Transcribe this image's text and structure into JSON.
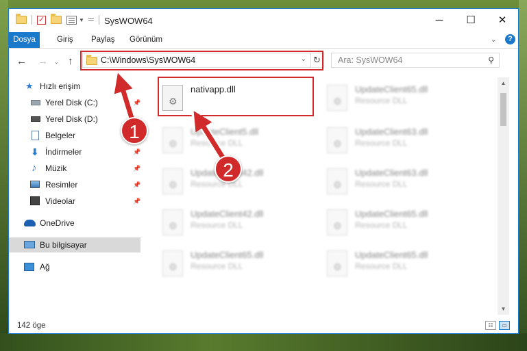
{
  "window": {
    "title": "SysWOW64"
  },
  "ribbon": {
    "tabs": [
      "Dosya",
      "Giriş",
      "Paylaş",
      "Görünüm"
    ],
    "help": "?"
  },
  "nav": {
    "address": "C:\\Windows\\SysWOW64",
    "search_placeholder": "Ara: SysWOW64"
  },
  "sidebar": {
    "items": [
      {
        "label": "Hızlı erişim",
        "icon": "star-icon"
      },
      {
        "label": "Yerel Disk (C:)",
        "icon": "drive-icon",
        "pinned": true
      },
      {
        "label": "Yerel Disk (D:)",
        "icon": "drive-icon"
      },
      {
        "label": "Belgeler",
        "icon": "documents-icon"
      },
      {
        "label": "İndirmeler",
        "icon": "download-icon",
        "pinned": true
      },
      {
        "label": "Müzik",
        "icon": "music-icon",
        "pinned": true
      },
      {
        "label": "Resimler",
        "icon": "pictures-icon",
        "pinned": true
      },
      {
        "label": "Videolar",
        "icon": "video-icon",
        "pinned": true
      },
      {
        "label": "OneDrive",
        "icon": "cloud-icon"
      },
      {
        "label": "Bu bilgisayar",
        "icon": "computer-icon",
        "selected": true
      },
      {
        "label": "Ağ",
        "icon": "network-icon"
      }
    ]
  },
  "files": [
    {
      "name": "nativapp.dll",
      "type": ""
    },
    {
      "name": "UpdateClient65.dll",
      "type": "Resource DLL"
    },
    {
      "name": "UpdateClient5.dll",
      "type": "Resource DLL"
    },
    {
      "name": "UpdateClient63.dll",
      "type": "Resource DLL"
    },
    {
      "name": "UpdateClient42.dll",
      "type": "Resource DLL"
    },
    {
      "name": "UpdateClient63.dll",
      "type": "Resource DLL"
    },
    {
      "name": "UpdateClient42.dll",
      "type": "Resource DLL"
    },
    {
      "name": "UpdateClient65.dll",
      "type": "Resource DLL"
    },
    {
      "name": "UpdateClient65.dll",
      "type": "Resource DLL"
    },
    {
      "name": "UpdateClient65.dll",
      "type": "Resource DLL"
    }
  ],
  "status": {
    "count": "142 öge"
  },
  "annotations": {
    "step1": "1",
    "step2": "2"
  },
  "colors": {
    "accent": "#1979ca",
    "highlight": "#d12a2a"
  }
}
